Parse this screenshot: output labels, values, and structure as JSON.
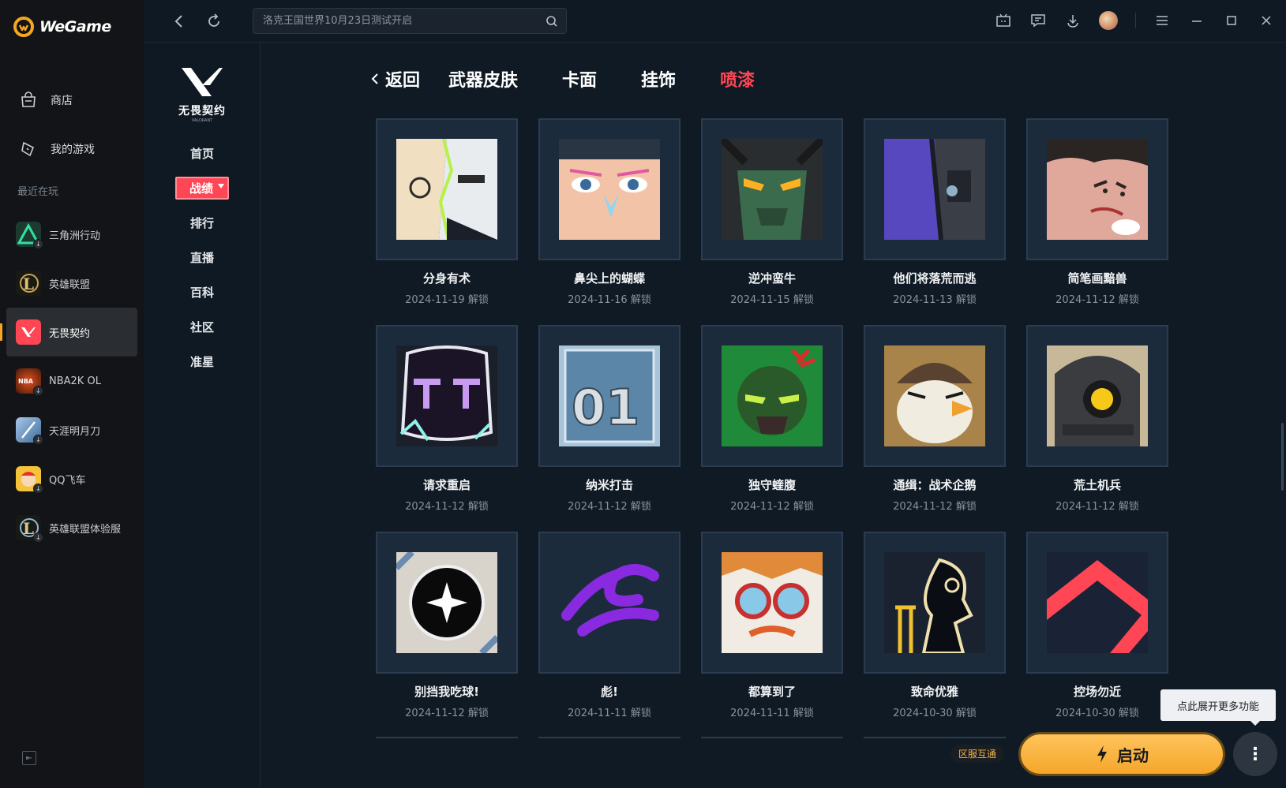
{
  "app": {
    "name": "WeGame",
    "brand_color": "#f5a623",
    "accent_red": "#ff4655"
  },
  "sidebar": {
    "main": [
      {
        "label": "商店",
        "icon": "shop-bag-icon"
      },
      {
        "label": "我的游戏",
        "icon": "gamepad-icon"
      }
    ],
    "recent_label": "最近在玩",
    "games": [
      {
        "label": "三角洲行动",
        "icon": "delta-force-icon",
        "download": true
      },
      {
        "label": "英雄联盟",
        "icon": "lol-icon",
        "download": false
      },
      {
        "label": "无畏契约",
        "icon": "valorant-icon",
        "download": false,
        "active": true
      },
      {
        "label": "NBA2K OL",
        "icon": "nba2k-icon",
        "download": true
      },
      {
        "label": "天涯明月刀",
        "icon": "tianya-icon",
        "download": true
      },
      {
        "label": "QQ飞车",
        "icon": "qq-speed-icon",
        "download": true
      },
      {
        "label": "英雄联盟体验服",
        "icon": "lol-pbe-icon",
        "download": true
      }
    ]
  },
  "topbar": {
    "search_placeholder": "洛克王国世界10月23日测试开启"
  },
  "game_sidebar": {
    "logo_title": "无畏契约",
    "logo_sub": "VALORANT",
    "nav": [
      "首页",
      "战绩",
      "排行",
      "直播",
      "百科",
      "社区",
      "准星"
    ],
    "active_nav": "战绩"
  },
  "tabs": {
    "back": "返回",
    "items": [
      "武器皮肤",
      "卡面",
      "挂饰",
      "喷漆"
    ],
    "active": "喷漆"
  },
  "sprays": [
    {
      "title": "分身有术",
      "date": "2024-11-19 解锁"
    },
    {
      "title": "鼻尖上的蝴蝶",
      "date": "2024-11-16 解锁"
    },
    {
      "title": "逆冲蛮牛",
      "date": "2024-11-15 解锁"
    },
    {
      "title": "他们将落荒而逃",
      "date": "2024-11-13 解锁"
    },
    {
      "title": "简笔画黯兽",
      "date": "2024-11-12 解锁"
    },
    {
      "title": "请求重启",
      "date": "2024-11-12 解锁"
    },
    {
      "title": "纳米打击",
      "date": "2024-11-12 解锁"
    },
    {
      "title": "独守蝰腹",
      "date": "2024-11-12 解锁"
    },
    {
      "title": "通缉：战术企鹅",
      "date": "2024-11-12 解锁"
    },
    {
      "title": "荒土机兵",
      "date": "2024-11-12 解锁"
    },
    {
      "title": "别挡我吃球!",
      "date": "2024-11-12 解锁"
    },
    {
      "title": "彪!",
      "date": "2024-11-11 解锁"
    },
    {
      "title": "都算到了",
      "date": "2024-11-11 解锁"
    },
    {
      "title": "致命优雅",
      "date": "2024-10-30 解锁"
    },
    {
      "title": "控场勿近",
      "date": "2024-10-30 解锁"
    }
  ],
  "footer": {
    "region_badge": "区服互通",
    "launch_label": "启动",
    "tooltip": "点此展开更多功能"
  }
}
